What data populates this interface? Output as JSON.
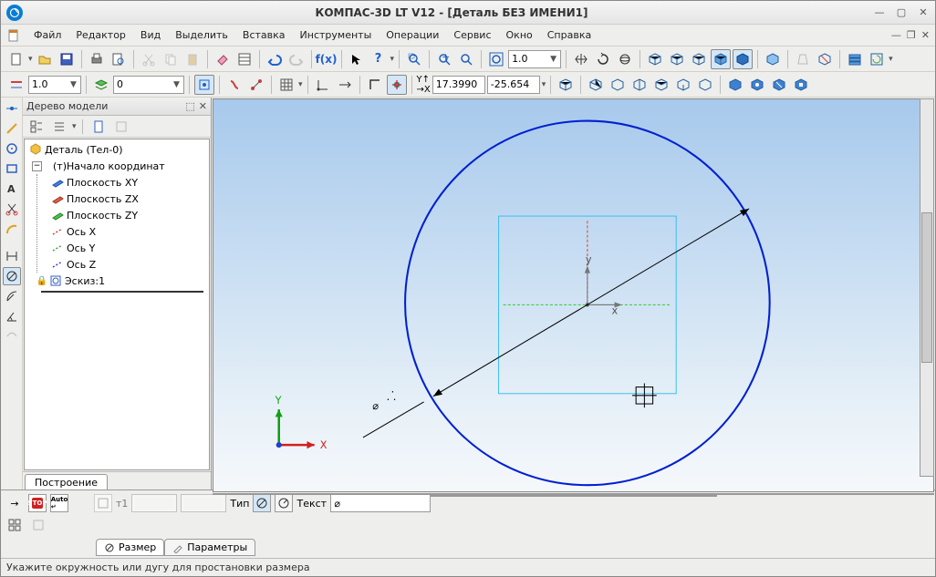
{
  "title": "КОМПАС-3D LT V12 - [Деталь БЕЗ ИМЕНИ1]",
  "menu": {
    "file": "Файл",
    "editor": "Редактор",
    "view": "Вид",
    "select": "Выделить",
    "insert": "Вставка",
    "tools": "Инструменты",
    "operations": "Операции",
    "service": "Сервис",
    "window": "Окно",
    "help": "Справка"
  },
  "toolbar1": {
    "zoom_combo": "1.0"
  },
  "toolbar2": {
    "style_combo": "1.0",
    "width_combo": "0",
    "coord_label": "Y↑X→",
    "coord_x": "17.3990",
    "coord_y": "-25.654"
  },
  "tree": {
    "title": "Дерево модели",
    "root": "Деталь (Тел-0)",
    "origin": "(т)Начало координат",
    "plane_xy": "Плоскость XY",
    "plane_zx": "Плоскость ZX",
    "plane_zy": "Плоскость ZY",
    "axis_x": "Ось X",
    "axis_y": "Ось Y",
    "axis_z": "Ось Z",
    "sketch": "Эскиз:1",
    "tab": "Построение"
  },
  "canvas": {
    "axis_x": "X",
    "axis_y": "Y",
    "center_x": "x",
    "center_y": "y",
    "dim_symbol": "⌀"
  },
  "props": {
    "type_label": "Тип",
    "text_label": "Текст",
    "text_value": "⌀",
    "t1_label": "т1",
    "tab_dimension": "Размер",
    "tab_params": "Параметры"
  },
  "status": "Укажите окружность или дугу для простановки размера"
}
